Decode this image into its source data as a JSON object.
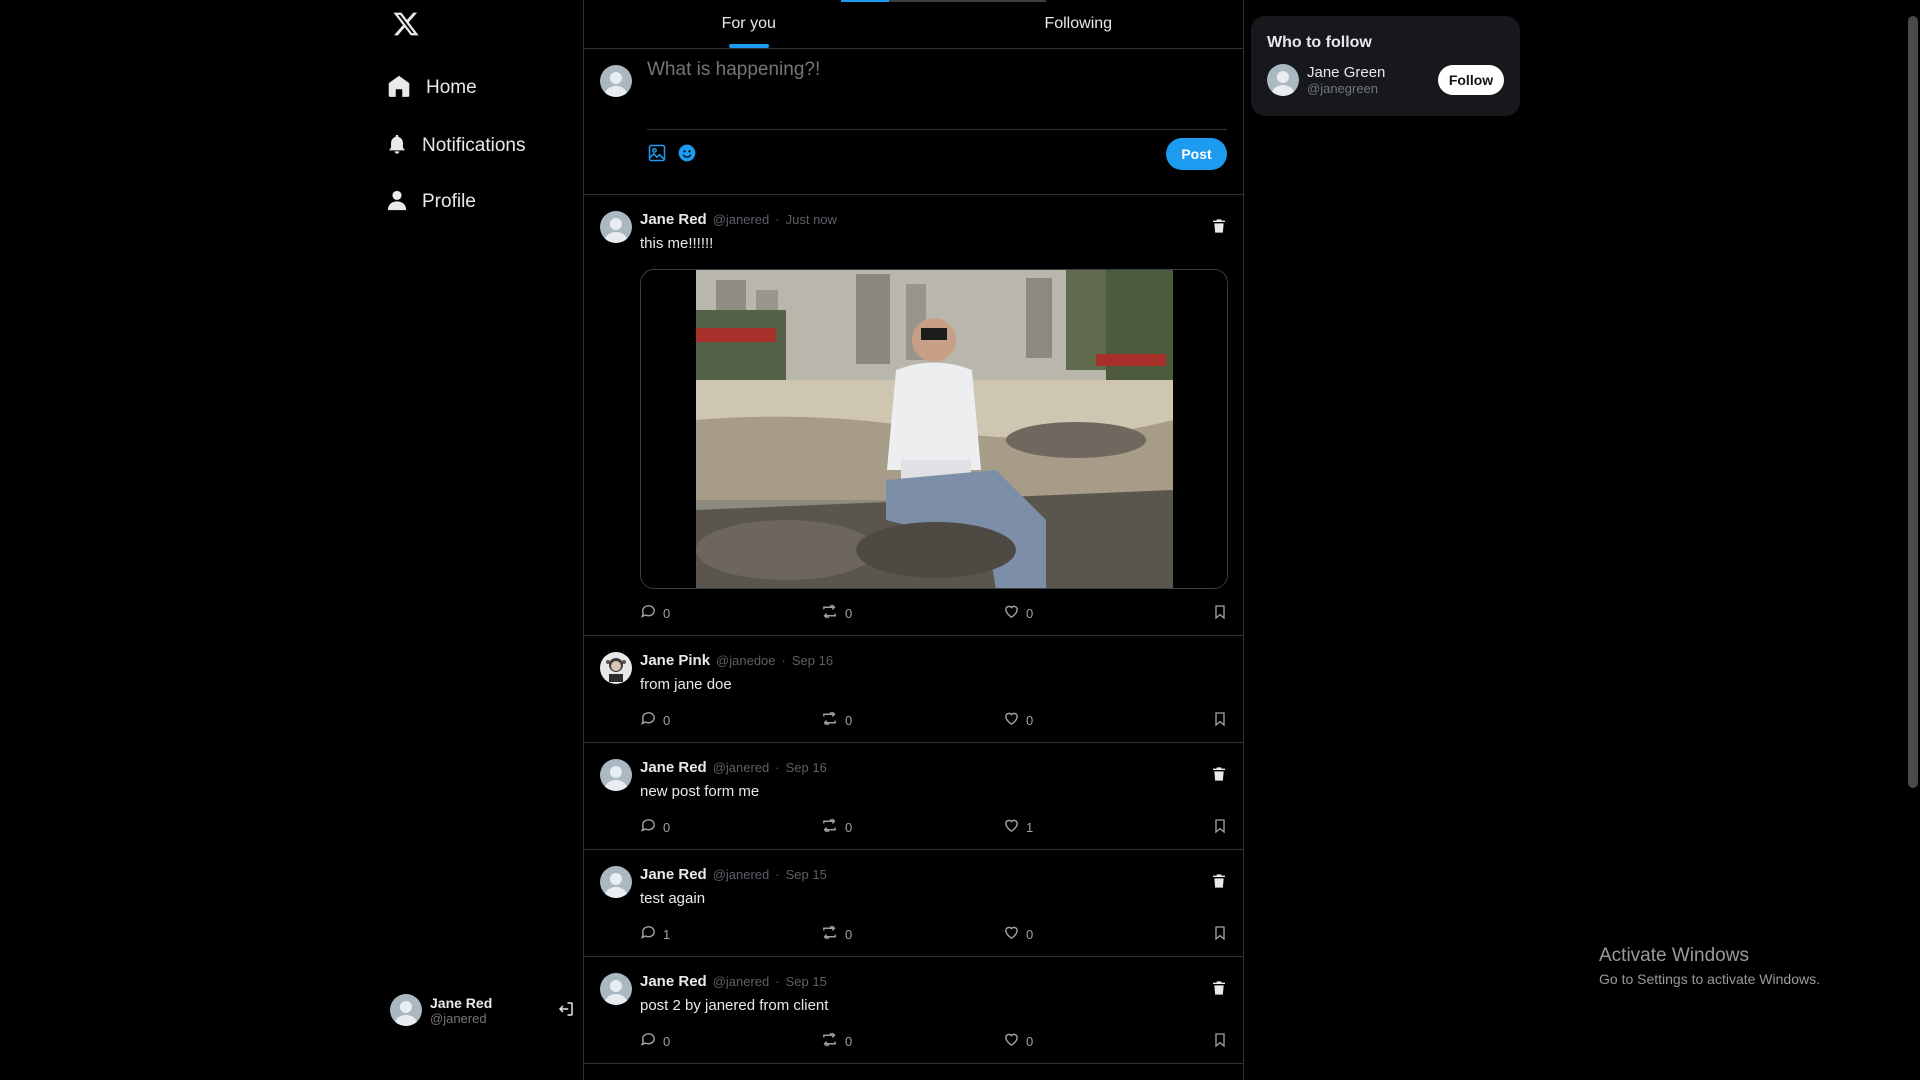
{
  "app": {
    "logo": "X"
  },
  "nav": {
    "items": [
      {
        "label": "Home",
        "icon": "home-icon"
      },
      {
        "label": "Notifications",
        "icon": "bell-icon"
      },
      {
        "label": "Profile",
        "icon": "person-icon"
      }
    ]
  },
  "account": {
    "name": "Jane Red",
    "handle": "@janered"
  },
  "tabs": [
    {
      "label": "For you",
      "active": true
    },
    {
      "label": "Following",
      "active": false
    }
  ],
  "composer": {
    "placeholder": "What is happening?!",
    "post_label": "Post"
  },
  "posts": [
    {
      "name": "Jane Red",
      "handle": "@janered",
      "time": "Just now",
      "text": "this me!!!!!!",
      "replies": "0",
      "retweets": "0",
      "likes": "0",
      "has_media": true,
      "deletable": true
    },
    {
      "name": "Jane Pink",
      "handle": "@janedoe",
      "time": "Sep 16",
      "text": "from jane doe",
      "replies": "0",
      "retweets": "0",
      "likes": "0",
      "has_media": false,
      "deletable": false
    },
    {
      "name": "Jane Red",
      "handle": "@janered",
      "time": "Sep 16",
      "text": "new post form me",
      "replies": "0",
      "retweets": "0",
      "likes": "1",
      "has_media": false,
      "deletable": true
    },
    {
      "name": "Jane Red",
      "handle": "@janered",
      "time": "Sep 15",
      "text": "test again",
      "replies": "1",
      "retweets": "0",
      "likes": "0",
      "has_media": false,
      "deletable": true
    },
    {
      "name": "Jane Red",
      "handle": "@janered",
      "time": "Sep 15",
      "text": "post 2 by janered from client",
      "replies": "0",
      "retweets": "0",
      "likes": "0",
      "has_media": false,
      "deletable": true
    }
  ],
  "who_to_follow": {
    "title": "Who to follow",
    "users": [
      {
        "name": "Jane Green",
        "handle": "@janegreen",
        "button": "Follow"
      }
    ]
  },
  "watermark": {
    "line1": "Activate Windows",
    "line2": "Go to Settings to activate Windows."
  },
  "colors": {
    "accent": "#1d9bf0",
    "background": "#000000",
    "border": "#2f3336",
    "muted": "#71767b"
  }
}
